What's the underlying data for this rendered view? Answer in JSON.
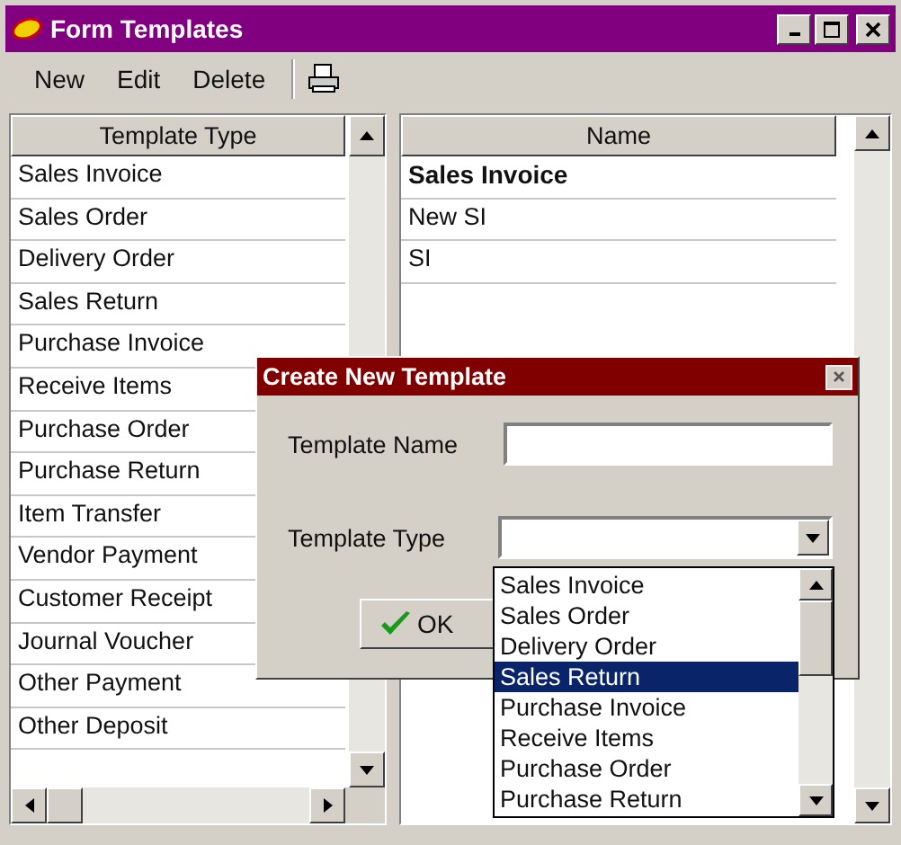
{
  "window": {
    "title": "Form Templates"
  },
  "toolbar": [
    "New",
    "Edit",
    "Delete"
  ],
  "types_grid": {
    "column": "Template Type",
    "rows": [
      "Sales Invoice",
      "Sales Order",
      "Delivery Order",
      "Sales Return",
      "Purchase Invoice",
      "Receive Items",
      "Purchase Order",
      "Purchase Return",
      "Item Transfer",
      "Vendor Payment",
      "Customer Receipt",
      "Journal Voucher",
      "Other Payment",
      "Other Deposit"
    ]
  },
  "names_grid": {
    "column": "Name",
    "rows": [
      {
        "text": "Sales Invoice",
        "default": true
      },
      {
        "text": "New SI",
        "default": false
      },
      {
        "text": "SI",
        "default": false
      }
    ]
  },
  "dialog": {
    "title": "Create New Template",
    "fields": [
      {
        "kind": "text",
        "label": "Template Name"
      },
      {
        "kind": "combo",
        "label": "Template Type"
      }
    ],
    "ok": "OK",
    "dropdown": [
      {
        "label": "Sales Invoice",
        "selected": false
      },
      {
        "label": "Sales Order",
        "selected": false
      },
      {
        "label": "Delivery Order",
        "selected": false
      },
      {
        "label": "Sales Return",
        "selected": true
      },
      {
        "label": "Purchase Invoice",
        "selected": false
      },
      {
        "label": "Receive Items",
        "selected": false
      },
      {
        "label": "Purchase Order",
        "selected": false
      },
      {
        "label": "Purchase Return",
        "selected": false
      }
    ]
  }
}
